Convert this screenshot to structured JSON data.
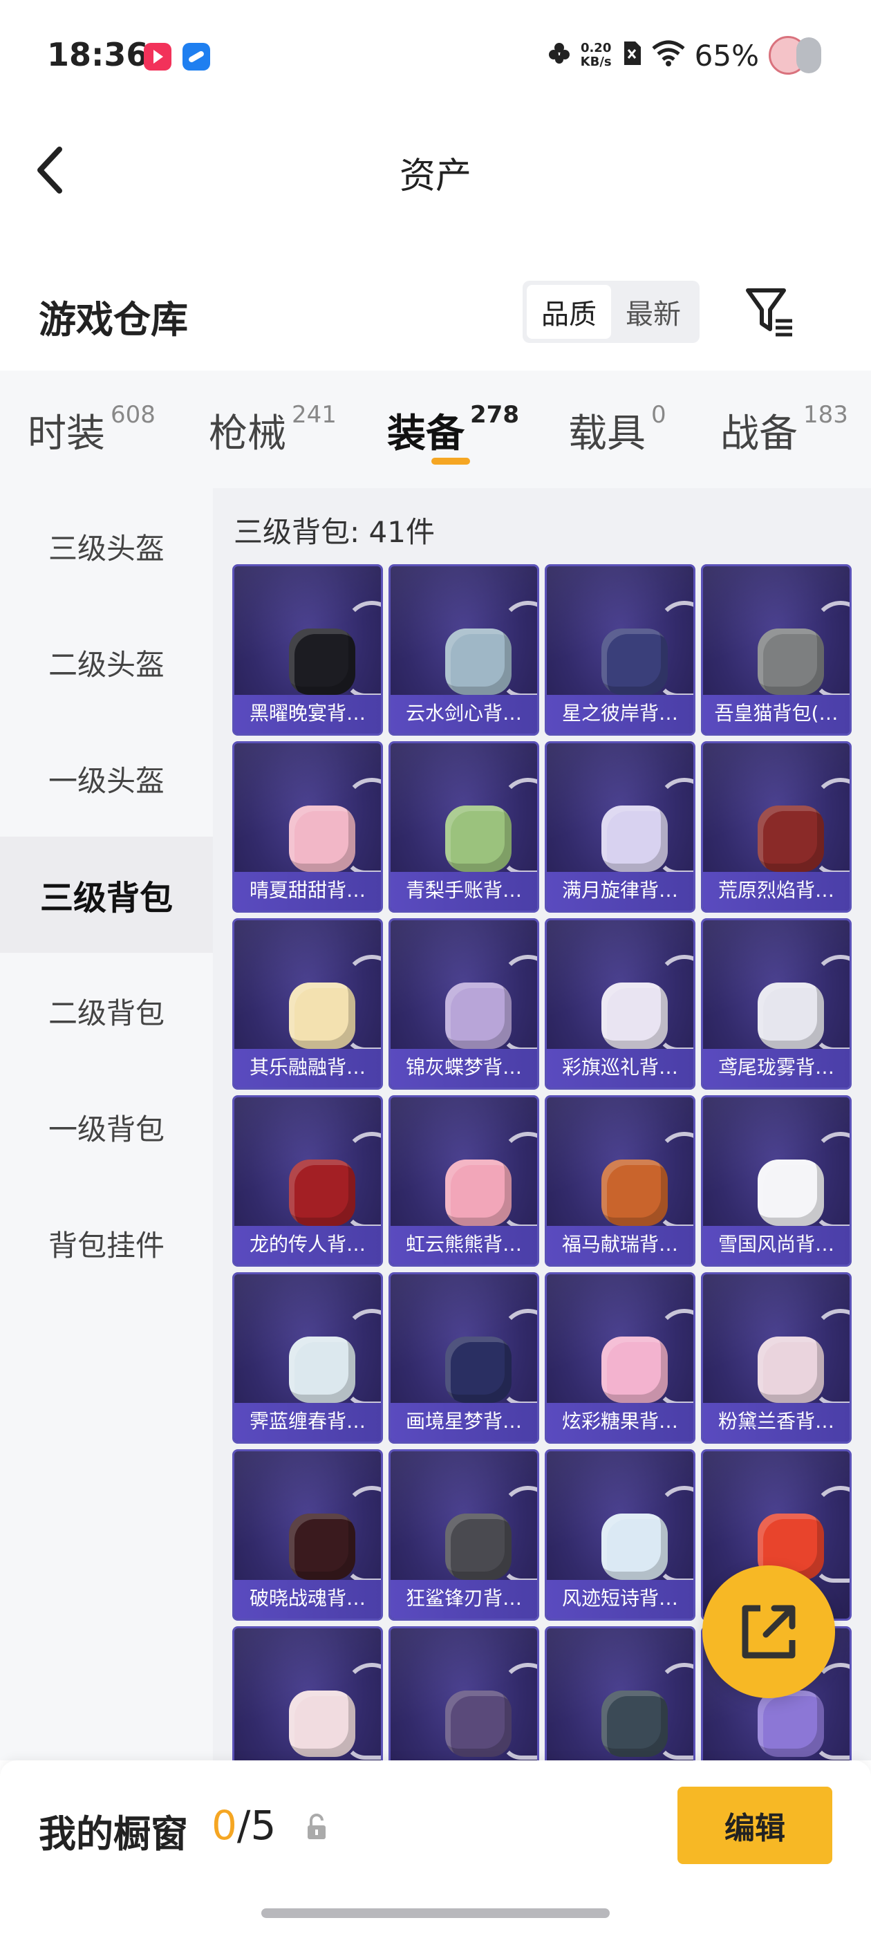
{
  "status_bar": {
    "time": "18:36",
    "net_speed_value": "0.20",
    "net_speed_unit": "KB/s",
    "battery": "65%",
    "icons": [
      "video-app-icon",
      "browser-app-icon",
      "flower-icon",
      "sim-icon",
      "wifi-icon",
      "avatar-icon"
    ]
  },
  "header": {
    "title": "资产"
  },
  "warehouse": {
    "title": "游戏仓库",
    "sort_options": [
      "品质",
      "最新"
    ],
    "active_sort": "品质"
  },
  "tabs": [
    {
      "label": "时装",
      "count": "608"
    },
    {
      "label": "枪械",
      "count": "241"
    },
    {
      "label": "装备",
      "count": "278"
    },
    {
      "label": "载具",
      "count": "0"
    },
    {
      "label": "战备",
      "count": "183"
    }
  ],
  "active_tab": "装备",
  "sidebar": {
    "items": [
      "三级头盔",
      "二级头盔",
      "一级头盔",
      "三级背包",
      "二级背包",
      "一级背包",
      "背包挂件"
    ],
    "active": "三级背包"
  },
  "section": {
    "title": "三级背包: 41件"
  },
  "items": [
    {
      "name": "黑曜晚宴背…",
      "color": "#1c1c22"
    },
    {
      "name": "云水剑心背…",
      "color": "#9fb7c6"
    },
    {
      "name": "星之彼岸背…",
      "color": "#3a3f7a"
    },
    {
      "name": "吾皇猫背包(…",
      "color": "#7d7f80"
    },
    {
      "name": "晴夏甜甜背…",
      "color": "#f2b7c7"
    },
    {
      "name": "青梨手账背…",
      "color": "#9bc27d"
    },
    {
      "name": "满月旋律背…",
      "color": "#d8d2f0"
    },
    {
      "name": "荒原烈焰背…",
      "color": "#8a2a28"
    },
    {
      "name": "其乐融融背…",
      "color": "#f3e1b0"
    },
    {
      "name": "锦灰蝶梦背…",
      "color": "#b8a5d8"
    },
    {
      "name": "彩旗巡礼背…",
      "color": "#e9e4f2"
    },
    {
      "name": "鸢尾珑雾背…",
      "color": "#e6e6ee"
    },
    {
      "name": "龙的传人背…",
      "color": "#a31f24"
    },
    {
      "name": "虹云熊熊背…",
      "color": "#f2a6b9"
    },
    {
      "name": "福马献瑞背…",
      "color": "#c9642c"
    },
    {
      "name": "雪国风尚背…",
      "color": "#f5f5f8"
    },
    {
      "name": "霁蓝缠春背…",
      "color": "#dce8ee"
    },
    {
      "name": "画境星梦背…",
      "color": "#2a2f62"
    },
    {
      "name": "炫彩糖果背…",
      "color": "#f3b3cf"
    },
    {
      "name": "粉黛兰香背…",
      "color": "#ead4dd"
    },
    {
      "name": "破晓战魂背…",
      "color": "#3a1a1e"
    },
    {
      "name": "狂鲨锋刃背…",
      "color": "#4a4a50"
    },
    {
      "name": "风迹短诗背…",
      "color": "#dbe9f4"
    },
    {
      "name": "",
      "color": "#e8442c"
    },
    {
      "name": "",
      "color": "#f1dce0"
    },
    {
      "name": "",
      "color": "#5a4a7a"
    },
    {
      "name": "",
      "color": "#3b4a56"
    },
    {
      "name": "",
      "color": "#8c77d6"
    }
  ],
  "showcase": {
    "label": "我的橱窗",
    "current": "0",
    "separator_total": "/5"
  },
  "edit_button": "编辑",
  "colors": {
    "accent": "#f7b825",
    "card_bg": "#322a6a",
    "card_border": "#5b52b8",
    "name_bar": "#5a4bbf"
  }
}
